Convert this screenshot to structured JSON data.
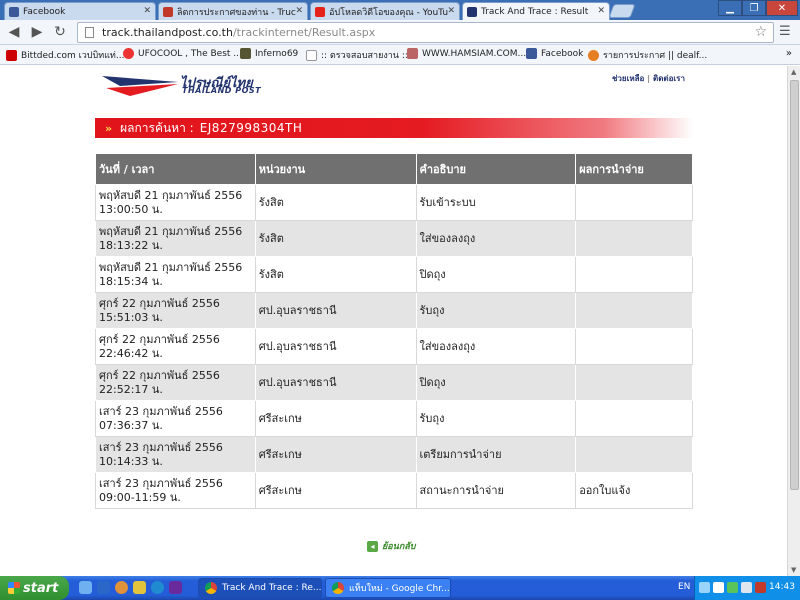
{
  "browser": {
    "tabs": [
      {
        "title": "Facebook",
        "active": false
      },
      {
        "title": "ลิตการประกาศของท่าน - Truc",
        "active": false
      },
      {
        "title": "อัปโหลดวิดีโอของคุณ - YouTu",
        "active": false
      },
      {
        "title": "Track And Trace : Result",
        "active": true
      }
    ],
    "url_host": "track.thailandpost.co.th",
    "url_path": "/trackinternet/Result.aspx",
    "bookmarks": [
      {
        "label": "Bittded.com เวปบิทแท่..."
      },
      {
        "label": "UFOCOOL , The Best ..."
      },
      {
        "label": "Inferno69"
      },
      {
        "label": ":: ตรวจสอบสายงาน ::"
      },
      {
        "label": "WWW.HAMSIAM.COM..."
      },
      {
        "label": "Facebook"
      },
      {
        "label": "รายการประกาศ || dealf..."
      }
    ]
  },
  "page": {
    "logo_th": "ไปรษณีย์ไทย",
    "logo_en": "THAILAND POST",
    "top_link_help": "ช่วยเหลือ",
    "top_link_contact": "ติดต่อเรา",
    "result_label": "ผลการค้นหา :",
    "tracking_code": "EJ827998304TH",
    "table": {
      "headers": [
        "วันที่ / เวลา",
        "หน่วยงาน",
        "คำอธิบาย",
        "ผลการนำจ่าย"
      ],
      "rows": [
        {
          "date": "พฤหัสบดี 21 กุมภาพันธ์ 2556",
          "time": "13:00:50 น.",
          "office": "รังสิต",
          "desc": "รับเข้าระบบ",
          "result": ""
        },
        {
          "date": "พฤหัสบดี 21 กุมภาพันธ์ 2556",
          "time": "18:13:22 น.",
          "office": "รังสิต",
          "desc": "ใส่ของลงถุง",
          "result": ""
        },
        {
          "date": "พฤหัสบดี 21 กุมภาพันธ์ 2556",
          "time": "18:15:34 น.",
          "office": "รังสิต",
          "desc": "ปิดถุง",
          "result": ""
        },
        {
          "date": "ศุกร์ 22 กุมภาพันธ์ 2556",
          "time": "15:51:03 น.",
          "office": "ศป.อุบลราชธานี",
          "desc": "รับถุง",
          "result": ""
        },
        {
          "date": "ศุกร์ 22 กุมภาพันธ์ 2556",
          "time": "22:46:42 น.",
          "office": "ศป.อุบลราชธานี",
          "desc": "ใส่ของลงถุง",
          "result": ""
        },
        {
          "date": "ศุกร์ 22 กุมภาพันธ์ 2556",
          "time": "22:52:17 น.",
          "office": "ศป.อุบลราชธานี",
          "desc": "ปิดถุง",
          "result": ""
        },
        {
          "date": "เสาร์ 23 กุมภาพันธ์ 2556",
          "time": "07:36:37 น.",
          "office": "ศรีสะเกษ",
          "desc": "รับถุง",
          "result": ""
        },
        {
          "date": "เสาร์ 23 กุมภาพันธ์ 2556",
          "time": "10:14:33 น.",
          "office": "ศรีสะเกษ",
          "desc": "เตรียมการนำจ่าย",
          "result": ""
        },
        {
          "date": "เสาร์ 23 กุมภาพันธ์ 2556",
          "time": "09:00-11:59 น.",
          "office": "ศรีสะเกษ",
          "desc": "สถานะการนำจ่าย",
          "result": "ออกใบแจ้ง"
        }
      ]
    },
    "back_label": "ย้อนกลับ"
  },
  "taskbar": {
    "start_label": "start",
    "buttons": [
      {
        "label": "Track And Trace : Re...",
        "active": true
      },
      {
        "label": "แท็บใหม่ - Google Chr...",
        "active": false
      }
    ],
    "language": "EN",
    "clock": "14:43"
  },
  "colors": {
    "banner_red": "#e51b22",
    "header_gray": "#707070",
    "row_alt": "#e4e4e4",
    "brand_navy": "#22336e",
    "taskbar_blue": "#245dd7"
  }
}
